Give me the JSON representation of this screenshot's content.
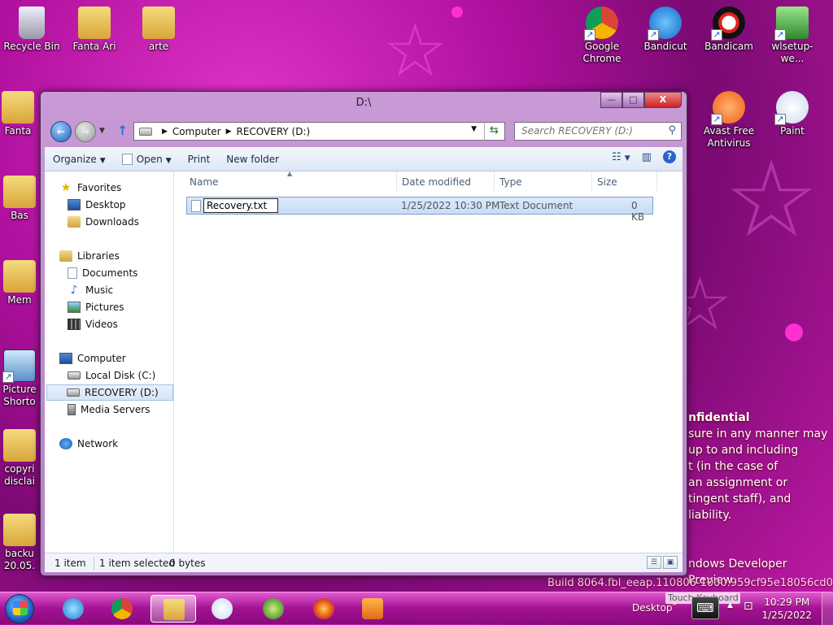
{
  "desktop": {
    "icons_left": [
      {
        "label": "Recycle Bin",
        "name": "recycle-bin"
      },
      {
        "label": "Fanta Ari",
        "name": "fanta-ari"
      },
      {
        "label": "arte",
        "name": "arte"
      },
      {
        "label": "Fanta",
        "name": "fanta"
      },
      {
        "label": "Bas",
        "name": "bas"
      },
      {
        "label": "Mem",
        "name": "mem"
      },
      {
        "label": "Picture Shorto",
        "name": "picture-shortcut"
      },
      {
        "label": "copyri disclai",
        "name": "copyright-disclaimer"
      },
      {
        "label": "backu 20.05.",
        "name": "backup"
      }
    ],
    "icons_right": [
      {
        "label": "Google Chrome",
        "name": "google-chrome"
      },
      {
        "label": "Bandicut",
        "name": "bandicut"
      },
      {
        "label": "Bandicam",
        "name": "bandicam"
      },
      {
        "label": "wlsetup-we...",
        "name": "wlsetup"
      },
      {
        "label": "Avast Free Antivirus",
        "name": "avast-free-antivirus"
      },
      {
        "label": "Paint",
        "name": "paint"
      }
    ],
    "watermark": {
      "heading": "nfidential",
      "lines": [
        "sure in any manner may",
        "up to and including",
        "t (in the case of",
        "an assignment or",
        "tingent staff), and",
        "liability."
      ],
      "preview": "ndows Developer Preview",
      "build": "Build 8064.fbl_eeap.110806-1000.959cf95e18056cd0"
    }
  },
  "window": {
    "title": "D:\\",
    "buttons": {
      "minimize": "—",
      "maximize": "□",
      "close": "X"
    },
    "address": {
      "crumb1": "Computer",
      "crumb2": "RECOVERY (D:)"
    },
    "search": {
      "placeholder": "Search RECOVERY (D:)"
    },
    "toolbar": {
      "organize": "Organize",
      "open": "Open",
      "print": "Print",
      "new_folder": "New folder"
    },
    "nav": {
      "favorites": "Favorites",
      "desktop": "Desktop",
      "downloads": "Downloads",
      "libraries": "Libraries",
      "documents": "Documents",
      "music": "Music",
      "pictures": "Pictures",
      "videos": "Videos",
      "computer": "Computer",
      "local_disk": "Local Disk (C:)",
      "recovery": "RECOVERY (D:)",
      "media_servers": "Media Servers",
      "network": "Network"
    },
    "columns": {
      "name": "Name",
      "date": "Date modified",
      "type": "Type",
      "size": "Size"
    },
    "file": {
      "name": "Recovery.txt",
      "date": "1/25/2022 10:30 PM",
      "type": "Text Document",
      "size": "0 KB"
    },
    "status": {
      "count": "1 item",
      "selected": "1 item selected",
      "bytes": "0 bytes"
    }
  },
  "taskbar": {
    "desktop_label": "Desktop",
    "touch_keyboard": "Touch Keyboard",
    "time": "10:29 PM",
    "date": "1/25/2022"
  }
}
